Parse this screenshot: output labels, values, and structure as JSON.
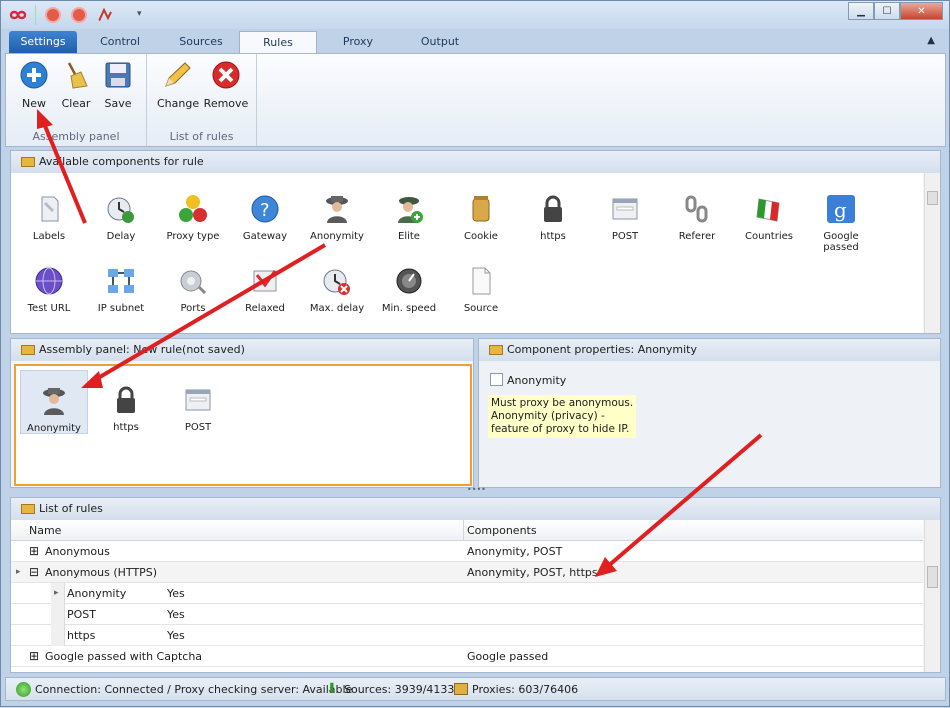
{
  "window": {
    "minimize": "▁",
    "maximize": "☐",
    "close": "✕"
  },
  "tabs": [
    {
      "label": "Settings"
    },
    {
      "label": "Control"
    },
    {
      "label": "Sources"
    },
    {
      "label": "Rules"
    },
    {
      "label": "Proxy"
    },
    {
      "label": "Output"
    }
  ],
  "ribbon": {
    "groups": [
      {
        "label": "Assembly panel"
      },
      {
        "label": "List of rules"
      }
    ],
    "buttons": [
      {
        "label": "New"
      },
      {
        "label": "Clear"
      },
      {
        "label": "Save"
      },
      {
        "label": "Change"
      },
      {
        "label": "Remove"
      }
    ]
  },
  "available": {
    "title": "Available components for rule",
    "components": [
      {
        "label": "Labels",
        "icon": "label-icon"
      },
      {
        "label": "Delay",
        "icon": "clock-icon"
      },
      {
        "label": "Proxy type",
        "icon": "traffic-balls-icon"
      },
      {
        "label": "Gateway",
        "icon": "help-globe-icon"
      },
      {
        "label": "Anonymity",
        "icon": "spy-icon"
      },
      {
        "label": "Elite",
        "icon": "elite-icon"
      },
      {
        "label": "Cookie",
        "icon": "cookie-jar-icon"
      },
      {
        "label": "https",
        "icon": "lock-icon"
      },
      {
        "label": "POST",
        "icon": "form-icon"
      },
      {
        "label": "Referer",
        "icon": "chain-icon"
      },
      {
        "label": "Countries",
        "icon": "flag-icon"
      },
      {
        "label": "Google passed",
        "icon": "google-icon"
      },
      {
        "label": "Test URL",
        "icon": "globe-icon"
      },
      {
        "label": "IP subnet",
        "icon": "network-icon"
      },
      {
        "label": "Ports",
        "icon": "port-icon"
      },
      {
        "label": "Relaxed",
        "icon": "relaxed-icon"
      },
      {
        "label": "Max. delay",
        "icon": "max-delay-icon"
      },
      {
        "label": "Min. speed",
        "icon": "speed-icon"
      },
      {
        "label": "Source",
        "icon": "file-icon"
      }
    ]
  },
  "assembly": {
    "title": "Assembly panel: New rule(not saved)",
    "items": [
      {
        "label": "Anonymity",
        "icon": "spy-icon"
      },
      {
        "label": "https",
        "icon": "lock-icon"
      },
      {
        "label": "POST",
        "icon": "form-icon"
      }
    ]
  },
  "properties": {
    "title": "Component properties: Anonymity",
    "checkbox_label": "Anonymity",
    "tooltip": [
      "Must proxy be anonymous.",
      "Anonymity (privacy) -",
      "feature of proxy to hide IP."
    ]
  },
  "rules": {
    "title": "List of rules",
    "columns": [
      "Name",
      "Components"
    ],
    "rows": [
      {
        "name": "Anonymous",
        "components": "Anonymity, POST",
        "expander": "⊞"
      },
      {
        "name": "Anonymous (HTTPS)",
        "components": "Anonymity, POST, https",
        "expander": "⊟"
      },
      {
        "name": "Anonymity",
        "value": "Yes"
      },
      {
        "name": "POST",
        "value": "Yes"
      },
      {
        "name": "https",
        "value": "Yes"
      },
      {
        "name": "Google passed with Captcha",
        "components": "Google passed",
        "expander": "⊞"
      }
    ]
  },
  "status": {
    "connection": "Connection: Connected / Proxy checking server: Available",
    "sources": "Sources: 3939/4133",
    "proxies": "Proxies: 603/76406"
  },
  "colors": {
    "accent": "#1f5fae",
    "arrow": "#e02020",
    "selection": "#f0a030"
  }
}
